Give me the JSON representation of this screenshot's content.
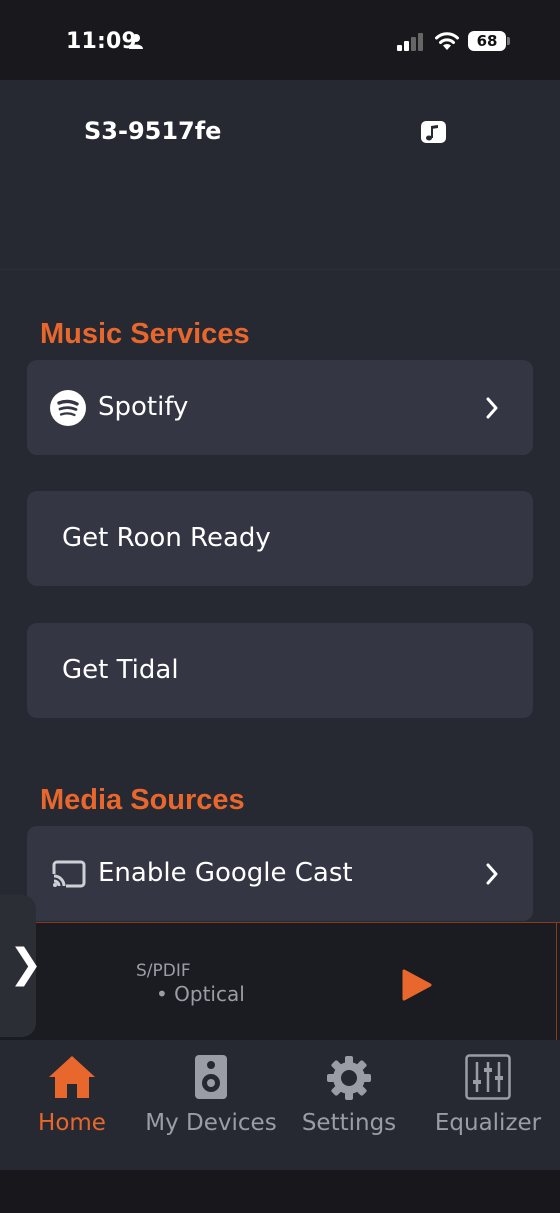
{
  "status_bar": {
    "time": "11:09",
    "battery": "68"
  },
  "header": {
    "device_name": "S3-9517fe"
  },
  "music_services": {
    "title": "Music Services",
    "items": [
      {
        "label": "Spotify",
        "icon": "spotify-icon",
        "has_chevron": true
      },
      {
        "label": "Get Roon Ready",
        "has_chevron": false
      },
      {
        "label": "Get Tidal",
        "has_chevron": false
      }
    ]
  },
  "media_sources": {
    "title": "Media Sources",
    "items": [
      {
        "label": "Enable Google Cast",
        "icon": "cast-icon",
        "has_chevron": true
      }
    ]
  },
  "player": {
    "source": "S/PDIF",
    "input": "• Optical"
  },
  "tabbar": {
    "items": [
      {
        "label": "Home",
        "icon": "home-icon",
        "active": true
      },
      {
        "label": "My Devices",
        "icon": "speaker-icon",
        "active": false
      },
      {
        "label": "Settings",
        "icon": "gear-icon",
        "active": false
      },
      {
        "label": "Equalizer",
        "icon": "equalizer-icon",
        "active": false
      }
    ]
  },
  "colors": {
    "accent": "#e8672c",
    "background": "#272932",
    "card": "#343644",
    "muted": "#9a9ca6"
  }
}
